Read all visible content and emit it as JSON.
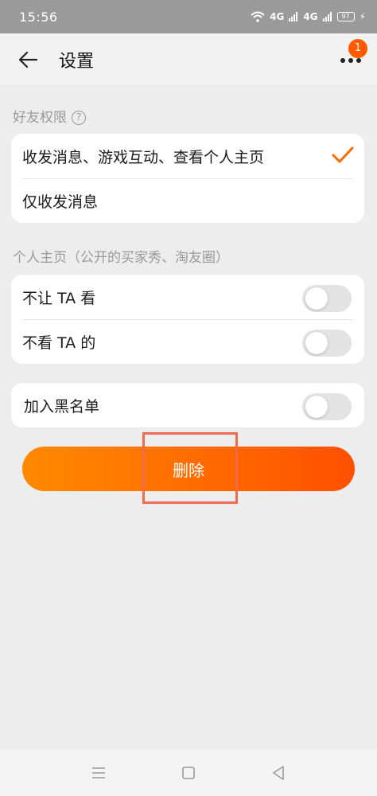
{
  "status_bar": {
    "time": "15:56",
    "signal_1": "4G",
    "signal_2": "4G",
    "battery": "97"
  },
  "header": {
    "title": "设置",
    "badge_count": "1"
  },
  "friend_permission": {
    "label": "好友权限",
    "help_glyph": "?",
    "options": [
      {
        "label": "收发消息、游戏互动、查看个人主页",
        "selected": true
      },
      {
        "label": "仅收发消息",
        "selected": false
      }
    ]
  },
  "profile": {
    "label": "个人主页（公开的买家秀、淘友圈）",
    "items": [
      {
        "label": "不让 TA 看",
        "on": false
      },
      {
        "label": "不看 TA 的",
        "on": false
      }
    ]
  },
  "blacklist": {
    "label": "加入黑名单",
    "on": false
  },
  "delete_button": {
    "label": "删除"
  },
  "colors": {
    "accent": "#ff6a00",
    "highlight": "#f06a4f"
  },
  "icons": [
    "back-arrow-icon",
    "more-dots-icon",
    "help-icon",
    "checkmark-icon",
    "menu-icon",
    "home-square-icon",
    "back-triangle-icon"
  ]
}
